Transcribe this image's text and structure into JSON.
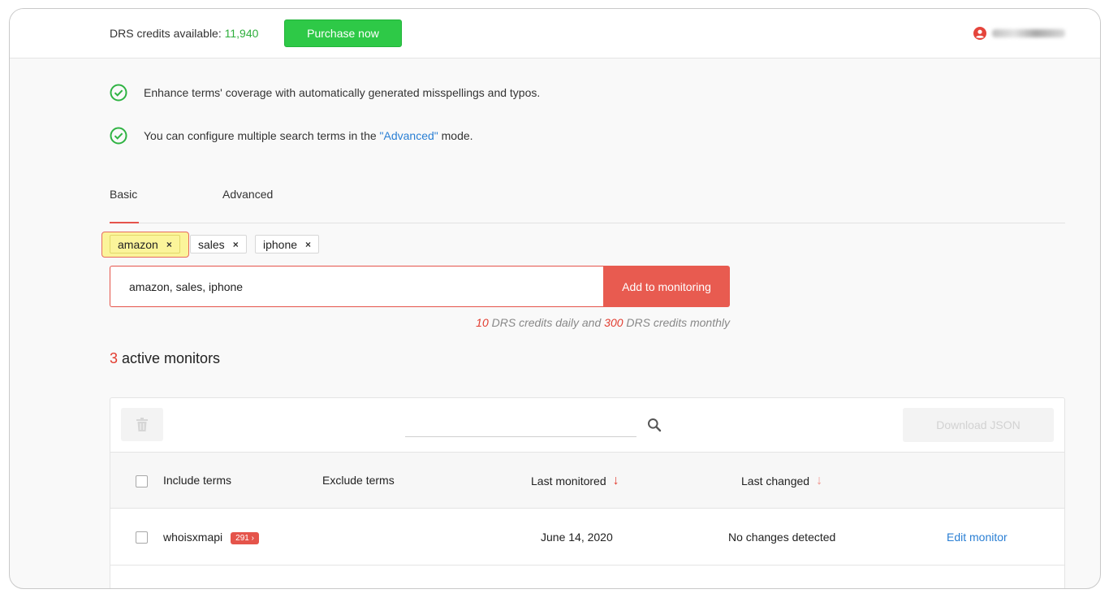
{
  "header": {
    "credits_label": "DRS credits available:",
    "credits_value": "11,940",
    "purchase_label": "Purchase now",
    "icons": {
      "user": "user-circle-icon"
    }
  },
  "tips": [
    {
      "icon": "check-circle-icon",
      "text": "Enhance terms' coverage with automatically generated misspellings and typos."
    },
    {
      "icon": "check-circle-icon",
      "text_before": "You can configure multiple search terms in the ",
      "link": "\"Advanced\"",
      "text_after": " mode."
    }
  ],
  "tabs": [
    {
      "label": "Basic",
      "active": true
    },
    {
      "label": "Advanced",
      "active": false
    }
  ],
  "chips": [
    {
      "label": "amazon",
      "remove": "×"
    },
    {
      "label": "sales",
      "remove": "×"
    },
    {
      "label": "iphone",
      "remove": "×"
    }
  ],
  "term_input": {
    "value": "amazon, sales, iphone"
  },
  "add_button": {
    "label": "Add to monitoring"
  },
  "cost_note": {
    "daily_value": "10",
    "daily_text": " DRS credits daily and ",
    "monthly_value": "300",
    "monthly_text": " DRS credits monthly"
  },
  "monitors": {
    "count": "3",
    "label": " active monitors"
  },
  "table": {
    "download_label": "Download JSON",
    "columns": {
      "include": "Include terms",
      "exclude": "Exclude terms",
      "last_monitored": "Last monitored",
      "last_changed": "Last changed"
    },
    "rows": [
      {
        "include": "whoisxmapi",
        "badge": "291",
        "badge_arrow": "›",
        "exclude": "",
        "last_monitored": "June 14, 2020",
        "last_changed": "No changes detected",
        "action": "Edit monitor"
      }
    ]
  },
  "colors": {
    "accent_red": "#e5544b",
    "green": "#2ec947",
    "link_blue": "#2a7fd4"
  }
}
